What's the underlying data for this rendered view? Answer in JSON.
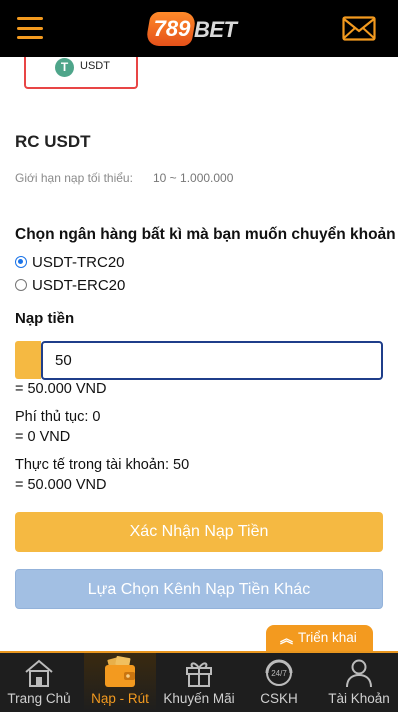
{
  "colors": {
    "accent": "#f39a1f",
    "confirm_button": "#f5b942",
    "alt_button": "#a2bfe3",
    "input_border": "#1f3e8a",
    "nav_bg": "#1e1e1e"
  },
  "header": {
    "logo_number": "789",
    "logo_text": "BET",
    "menu_icon": "hamburger-icon",
    "mail_icon": "mail-icon"
  },
  "method_card": {
    "icon": "tether-icon",
    "icon_glyph": "T",
    "label": "USDT"
  },
  "section": {
    "title": "RC USDT",
    "limit_label": "Giới hạn nạp tối thiểu:",
    "limit_value": "10 ~ 1.000.000"
  },
  "bank": {
    "title": "Chọn ngân hàng bất kì mà bạn muốn chuyển khoản",
    "options": [
      {
        "label": "USDT-TRC20",
        "selected": true
      },
      {
        "label": "USDT-ERC20",
        "selected": false
      }
    ]
  },
  "deposit": {
    "title": "Nạp tiền",
    "amount_value": "50",
    "converted": "= 50.000 VND",
    "fee_label": "Phí thủ tục: 0",
    "fee_converted": "= 0 VND",
    "actual_label": "Thực tế trong tài khoản: 50",
    "actual_converted": "= 50.000 VND"
  },
  "buttons": {
    "confirm": "Xác Nhận Nạp Tiền",
    "alternative": "Lựa Chọn Kênh Nạp Tiền Khác"
  },
  "expand_tab": {
    "icon": "double-chevron-up-icon",
    "label": "Triển khai"
  },
  "bottom_nav": [
    {
      "label": "Trang Chủ",
      "icon": "home-icon",
      "active": false
    },
    {
      "label": "Nạp - Rút",
      "icon": "wallet-icon",
      "active": true
    },
    {
      "label": "Khuyến Mãi",
      "icon": "gift-icon",
      "active": false
    },
    {
      "label": "CSKH",
      "icon": "support-24-7-icon",
      "active": false
    },
    {
      "label": "Tài Khoản",
      "icon": "user-icon",
      "active": false
    }
  ]
}
